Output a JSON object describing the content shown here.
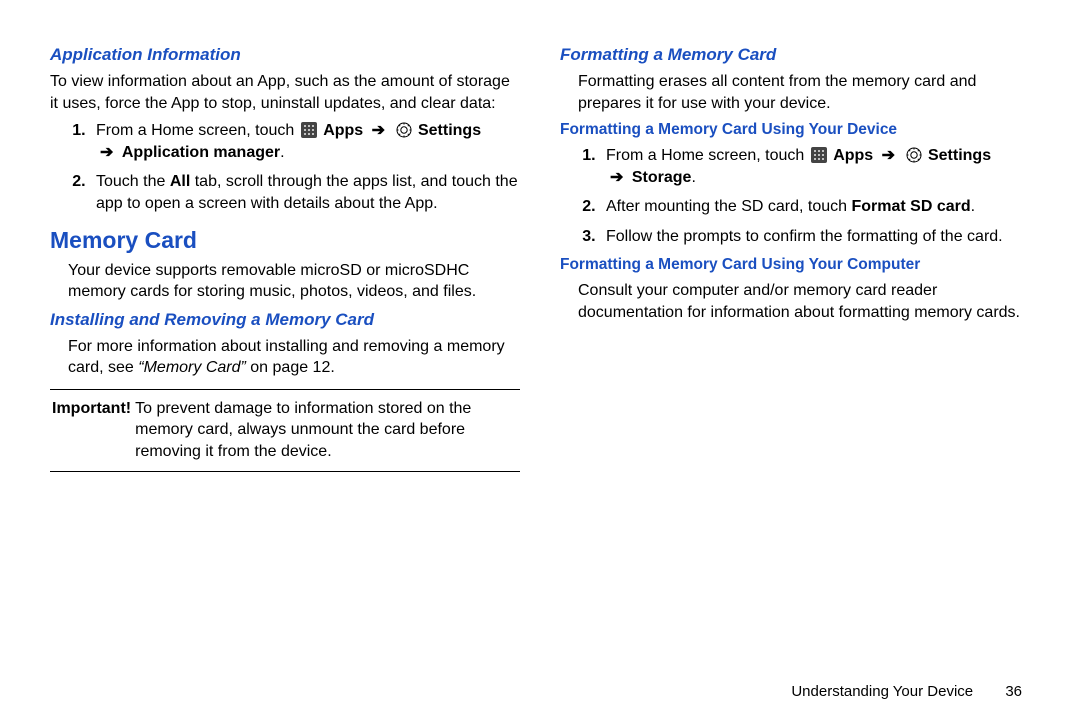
{
  "left": {
    "app_info": {
      "heading": "Application Information",
      "intro": "To view information about an App, such as the amount of storage it uses, force the App to stop, uninstall updates, and clear data:",
      "step1_a": "From a Home screen, touch ",
      "apps_label": "Apps",
      "settings_label": "Settings",
      "step1_b": "Application manager",
      "step2_a": "Touch the ",
      "step2_all": "All",
      "step2_b": " tab, scroll through the apps list, and touch the app to open a screen with details about the App."
    },
    "memory": {
      "heading": "Memory Card",
      "intro": "Your device supports removable microSD or microSDHC memory cards for storing music, photos, videos, and files."
    },
    "installing": {
      "heading": "Installing and Removing a Memory Card",
      "text_a": "For more information about installing and removing a memory card, see ",
      "text_ref": "“Memory Card”",
      "text_b": " on page 12."
    },
    "important": {
      "label": "Important!",
      "text": "To prevent damage to information stored on the memory card, always unmount the card before removing it from the device."
    }
  },
  "right": {
    "formatting": {
      "heading": "Formatting a Memory Card",
      "intro": "Formatting erases all content from the memory card and prepares it for use with your device."
    },
    "using_device": {
      "heading": "Formatting a Memory Card Using Your Device",
      "step1_a": "From a Home screen, touch ",
      "apps_label": "Apps",
      "settings_label": "Settings",
      "step1_b": "Storage",
      "step2_a": "After mounting the SD card, touch ",
      "step2_b": "Format SD card",
      "step2_c": ".",
      "step3": "Follow the prompts to confirm the formatting of the card."
    },
    "using_computer": {
      "heading": "Formatting a Memory Card Using Your Computer",
      "text": "Consult your computer and/or memory card reader documentation for information about formatting memory cards."
    }
  },
  "footer": {
    "section": "Understanding Your Device",
    "page": "36"
  },
  "glyphs": {
    "arrow": "➔"
  }
}
